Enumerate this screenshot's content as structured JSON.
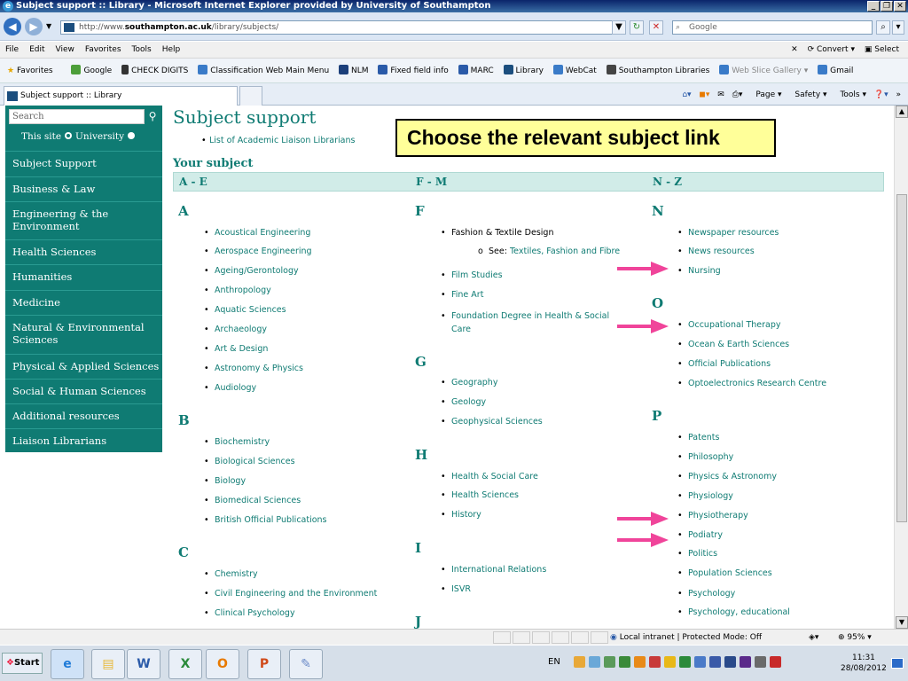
{
  "window": {
    "title": "Subject support :: Library - Microsoft Internet Explorer provided by University of Southampton"
  },
  "address": {
    "prefix": "http://www.",
    "domain": "southampton.ac.uk",
    "path": "/library/subjects/",
    "search_placeholder": "Google"
  },
  "menu": {
    "items": [
      "File",
      "Edit",
      "View",
      "Favorites",
      "Tools",
      "Help"
    ],
    "convert": "Convert",
    "select": "Select"
  },
  "favorites": {
    "label": "Favorites",
    "items": [
      "Google",
      "CHECK DIGITS",
      "Classification Web Main Menu",
      "NLM",
      "Fixed field info",
      "MARC",
      "Library",
      "WebCat",
      "Southampton Libraries",
      "Web Slice Gallery",
      "Gmail"
    ]
  },
  "tab": {
    "title": "Subject support :: Library"
  },
  "commandbar": {
    "page": "Page",
    "safety": "Safety",
    "tools": "Tools"
  },
  "sidebar": {
    "search_placeholder": "Search",
    "radio_this_site": "This site",
    "radio_university": "University",
    "items": [
      "Subject Support",
      "Business & Law",
      "Engineering & the Environment",
      "Health Sciences",
      "Humanities",
      "Medicine",
      "Natural & Environmental Sciences",
      "Physical & Applied Sciences",
      "Social & Human Sciences",
      "Additional resources",
      "Liaison Librarians"
    ]
  },
  "main": {
    "title": "Subject support",
    "liaison_link": "List of Academic Liaison Librarians",
    "callout": "Choose the relevant subject link",
    "your_subject": "Your subject",
    "ranges": [
      "A - E",
      "F - M",
      "N - Z"
    ],
    "col1": {
      "A": [
        "Acoustical Engineering",
        "Aerospace Engineering",
        "Ageing/Gerontology",
        "Anthropology",
        "Aquatic Sciences",
        "Archaeology",
        "Art & Design",
        "Astronomy & Physics",
        "Audiology"
      ],
      "B": [
        "Biochemistry",
        "Biological Sciences",
        "Biology",
        "Biomedical Sciences",
        "British Official Publications"
      ],
      "C": [
        "Chemistry",
        "Civil Engineering and the Environment",
        "Clinical Psychology"
      ]
    },
    "col2": {
      "F": [
        "Fashion & Textile Design",
        "Film Studies",
        "Fine Art",
        "Foundation Degree in Health & Social Care"
      ],
      "see_prefix": "See:",
      "see_link": "Textiles, Fashion and Fibre",
      "G": [
        "Geography",
        "Geology",
        "Geophysical Sciences"
      ],
      "H": [
        "Health & Social Care",
        "Health Sciences",
        "History"
      ],
      "I": [
        "International Relations",
        "ISVR"
      ],
      "J_letter": "J"
    },
    "col3": {
      "N": [
        "Newspaper resources",
        "News resources",
        "Nursing"
      ],
      "O": [
        "Occupational Therapy",
        "Ocean & Earth Sciences",
        "Official Publications",
        "Optoelectronics Research Centre"
      ],
      "P": [
        "Patents",
        "Philosophy",
        "Physics & Astronomy",
        "Physiology",
        "Physiotherapy",
        "Podiatry",
        "Politics",
        "Population Sciences",
        "Psychology",
        "Psychology, educational"
      ]
    },
    "letters": {
      "A": "A",
      "B": "B",
      "C": "C",
      "F": "F",
      "G": "G",
      "H": "H",
      "I": "I",
      "N": "N",
      "O": "O",
      "P": "P"
    }
  },
  "status": {
    "zone": "Local intranet | Protected Mode: Off",
    "zoom": "95%"
  },
  "taskbar": {
    "start": "Start",
    "lang": "EN",
    "time": "11:31",
    "date": "28/08/2012"
  },
  "colors": {
    "teal": "#0f7b73",
    "callout_bg": "#ffff99",
    "arrow": "#f0449a",
    "range_bar": "#d1ece8"
  },
  "icons": [
    "back-icon",
    "forward-icon",
    "refresh-icon",
    "stop-icon",
    "search-icon",
    "favorites-star-icon",
    "home-icon",
    "rss-icon",
    "mail-icon",
    "print-icon",
    "help-icon",
    "windows-logo-icon",
    "ie-icon",
    "explorer-icon",
    "word-icon",
    "excel-icon",
    "outlook-icon",
    "powerpoint-icon",
    "paint-icon"
  ]
}
